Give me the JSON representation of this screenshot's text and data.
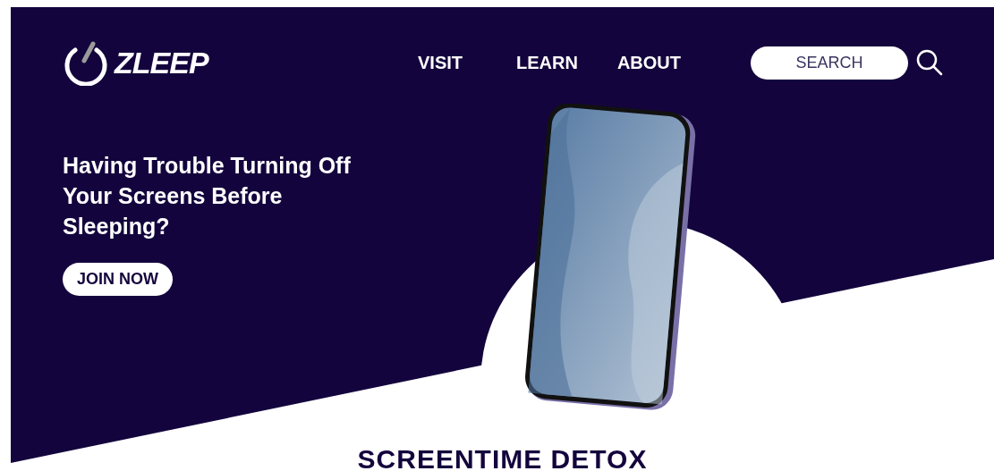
{
  "header": {
    "logo": "ZLEEP",
    "nav": [
      {
        "label": "VISIT"
      },
      {
        "label": "LEARN"
      },
      {
        "label": "ABOUT"
      }
    ],
    "search": {
      "placeholder": "SEARCH"
    }
  },
  "hero": {
    "headline": "Having Trouble Turning Off Your Screens Before Sleeping?",
    "button": "JOIN NOW"
  },
  "section": {
    "title": "SCREENTIME DETOX"
  }
}
